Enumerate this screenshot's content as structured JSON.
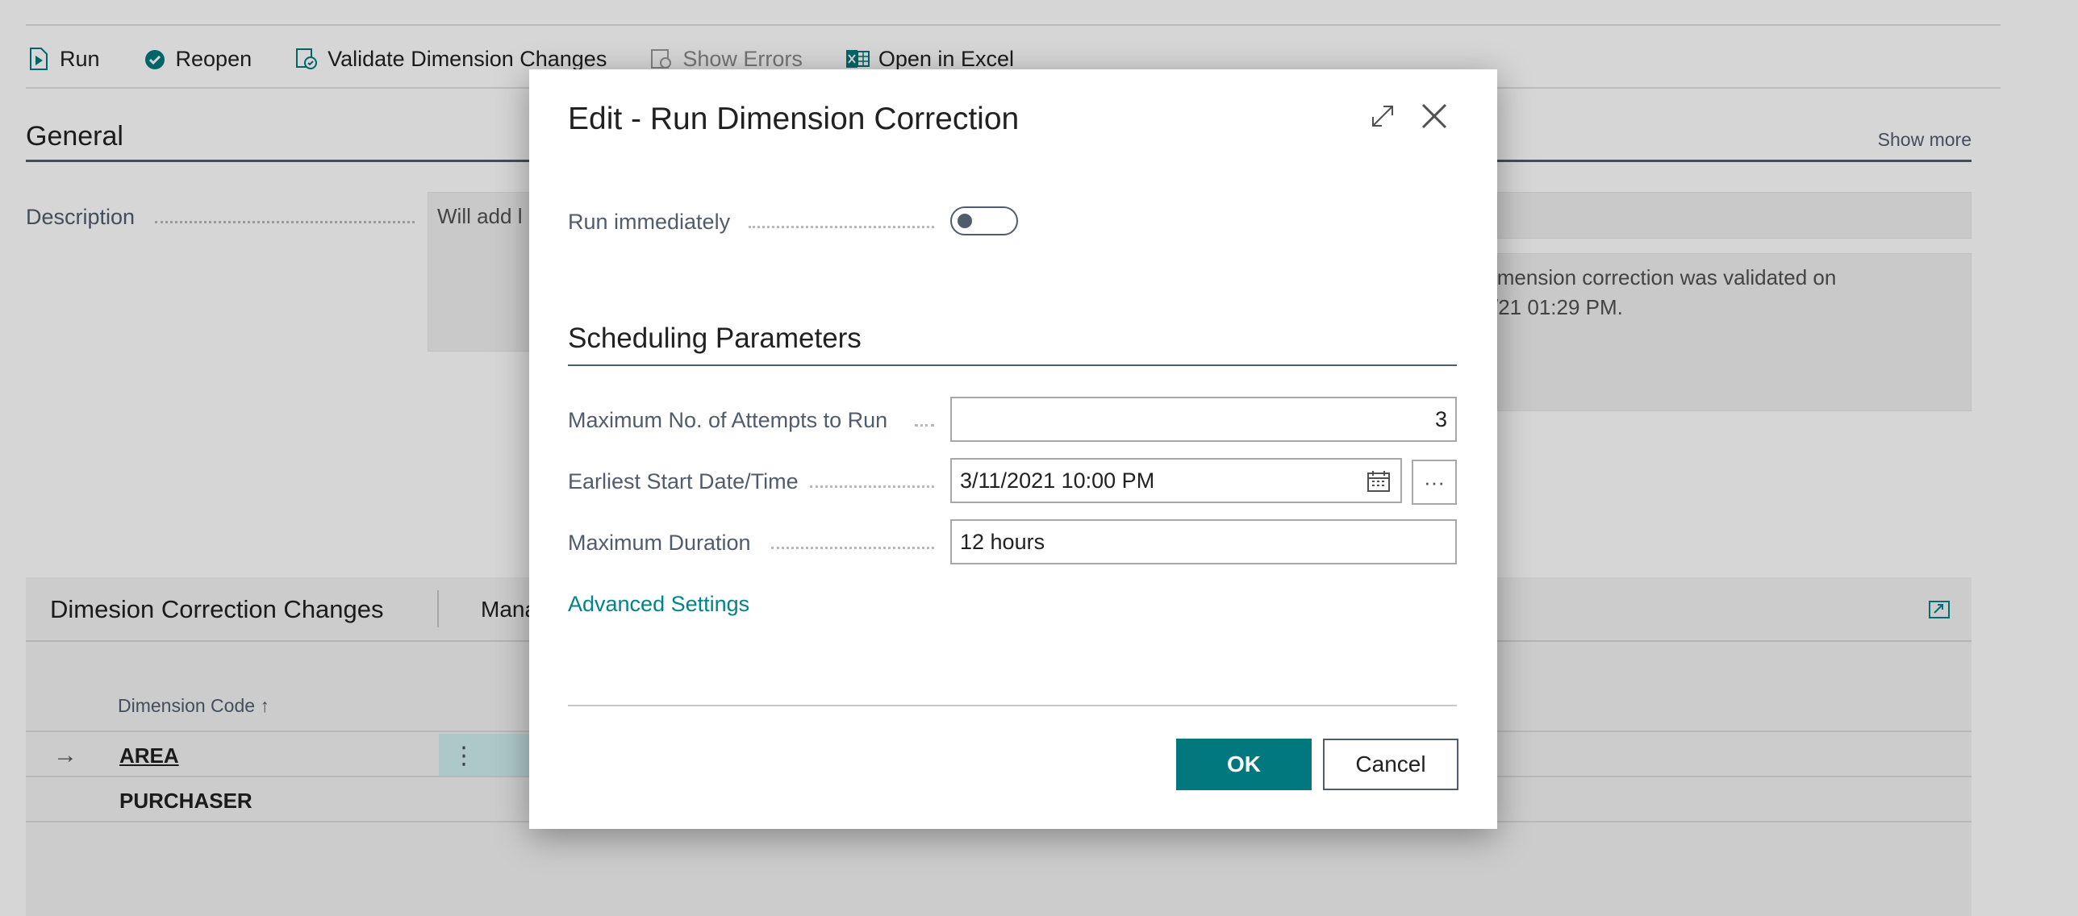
{
  "actions": {
    "run": "Run",
    "reopen": "Reopen",
    "validate": "Validate Dimension Changes",
    "show_errors": "Show Errors",
    "open_excel": "Open in Excel"
  },
  "general": {
    "title": "General",
    "show_more": "Show more",
    "description_label": "Description",
    "description_value": "Will add l",
    "status_text_line1": "imension correction was validated on",
    "status_text_line2": "/21 01:29 PM."
  },
  "changes_part": {
    "title": "Dimesion Correction Changes",
    "manage_label": "Mana",
    "column_header": "Dimension Code ↑",
    "rows": [
      {
        "code": "AREA"
      },
      {
        "code": "PURCHASER"
      }
    ]
  },
  "dialog": {
    "title": "Edit - Run Dimension Correction",
    "run_immediately_label": "Run immediately",
    "run_immediately_value": false,
    "scheduling_title": "Scheduling Parameters",
    "max_attempts_label": "Maximum No. of Attempts to Run",
    "max_attempts_value": "3",
    "earliest_start_label": "Earliest Start Date/Time",
    "earliest_start_value": "3/11/2021 10:00 PM",
    "max_duration_label": "Maximum Duration",
    "max_duration_value": "12 hours",
    "advanced_settings": "Advanced Settings",
    "ok_label": "OK",
    "cancel_label": "Cancel"
  },
  "colors": {
    "accent": "#00787d",
    "link": "#008489",
    "label": "#505c6d"
  }
}
